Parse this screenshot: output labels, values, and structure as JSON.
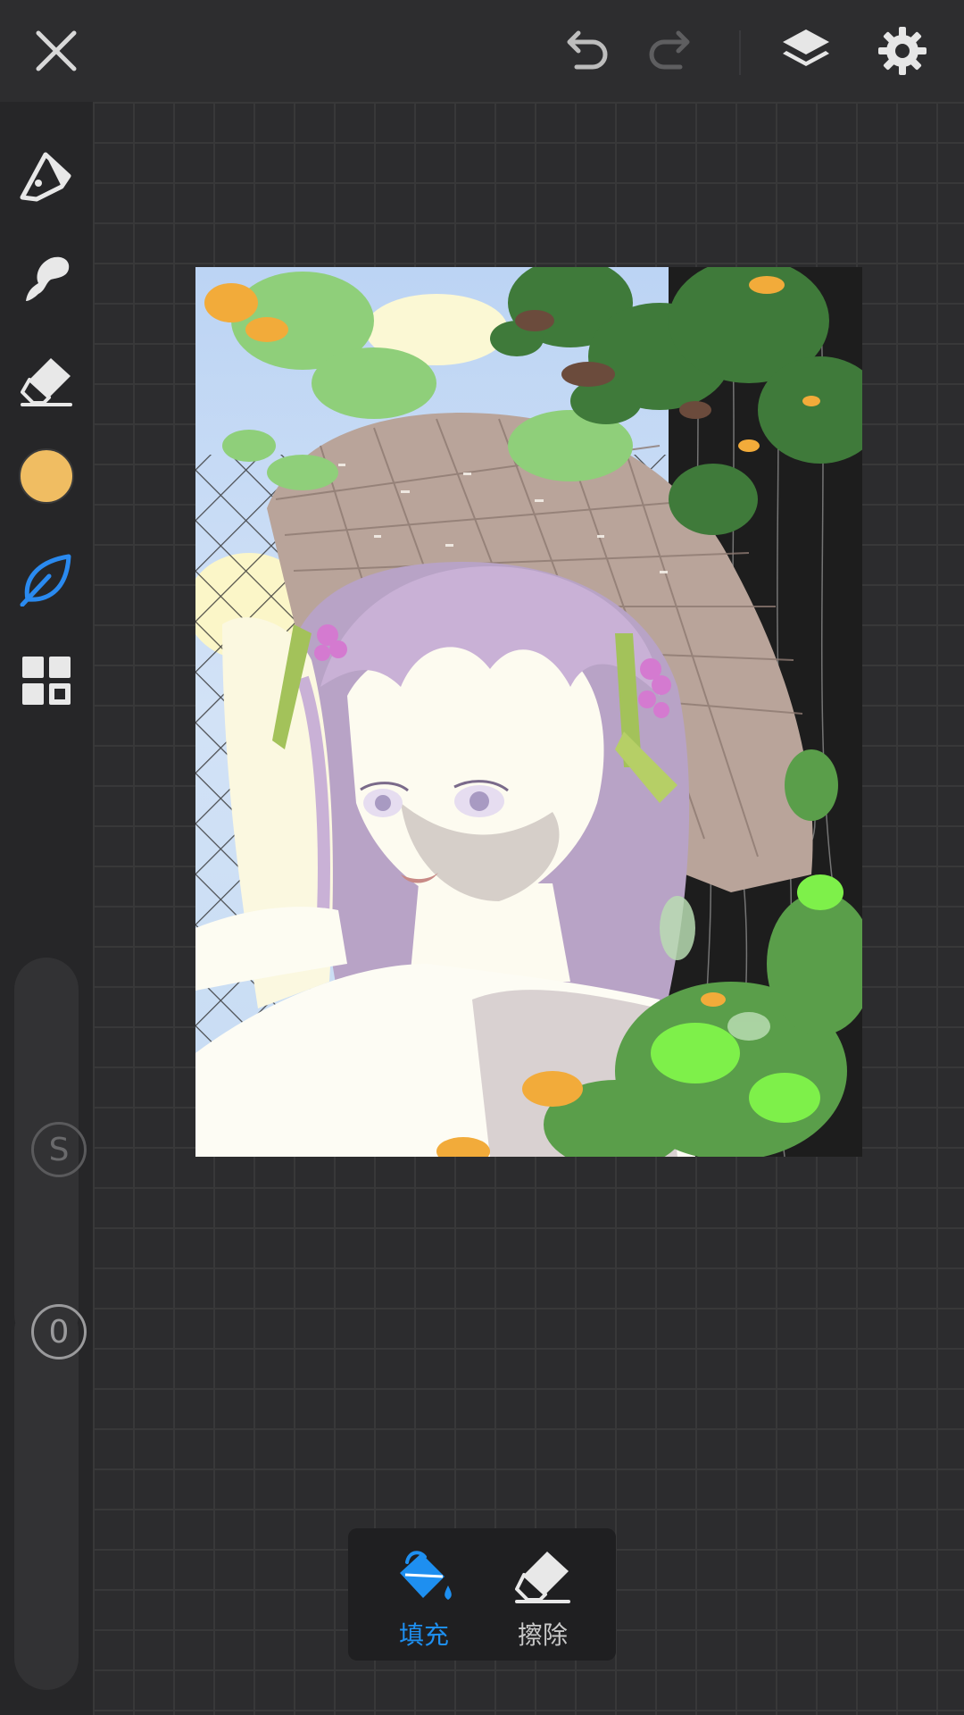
{
  "topbar": {
    "close_icon": "close-icon",
    "undo_icon": "undo-icon",
    "redo_icon": "redo-icon",
    "layers_icon": "layers-icon",
    "settings_icon": "gear-icon"
  },
  "sidebar": {
    "tools": [
      {
        "name": "pen",
        "icon": "pen-nib-icon"
      },
      {
        "name": "smudge",
        "icon": "smudge-icon"
      },
      {
        "name": "eraser",
        "icon": "eraser-icon"
      },
      {
        "name": "color",
        "icon": "color-swatch",
        "color": "#f0bd62"
      },
      {
        "name": "leaf",
        "icon": "leaf-icon",
        "active": true
      },
      {
        "name": "gallery",
        "icon": "grid-icon"
      }
    ],
    "size_slider_label": "S",
    "opacity_slider_label": "0"
  },
  "bottom_tools": {
    "fill_label": "填充",
    "erase_label": "擦除",
    "active": "fill"
  },
  "colors": {
    "accent": "#1e8ff0",
    "active_tool": "#2a8af0"
  }
}
